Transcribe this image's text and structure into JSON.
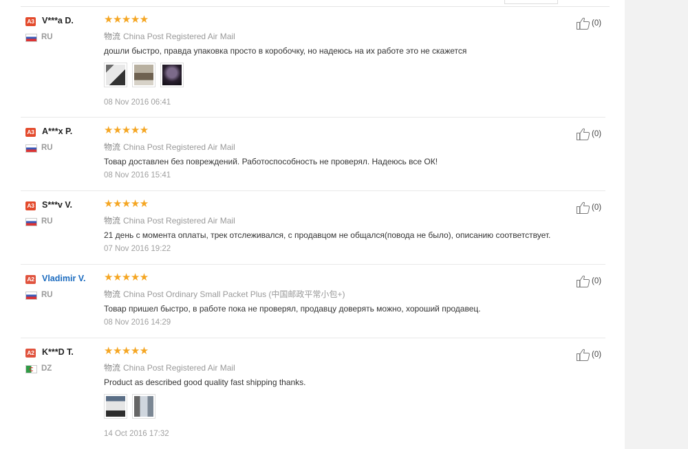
{
  "logistics_label": "物流",
  "icons": {
    "helpful": "thumbs-up-icon",
    "rating": "star-icon"
  },
  "colors": {
    "stars": "#f5a623",
    "badge": "#e34a2c",
    "buyer_highlight": "#1b6bbf"
  },
  "reviews": [
    {
      "level": "A3",
      "buyer": "V***a D.",
      "country": "RU",
      "stars": "★★★★★",
      "rating": 5,
      "shipping": "China Post Registered Air Mail",
      "feedback": "дошли быстро, правда упаковка просто в коробочку, но надеюсь на их работе это не скажется",
      "photos": 3,
      "date": "08 Nov 2016 06:41",
      "helpful": "(0)"
    },
    {
      "level": "A3",
      "buyer": "A***x P.",
      "country": "RU",
      "stars": "★★★★★",
      "rating": 5,
      "shipping": "China Post Registered Air Mail",
      "feedback": "Товар доставлен без повреждений. Работоспособность не проверял. Надеюсь все ОК!",
      "photos": 0,
      "date": "08 Nov 2016 15:41",
      "helpful": "(0)"
    },
    {
      "level": "A3",
      "buyer": "S***v V.",
      "country": "RU",
      "stars": "★★★★★",
      "rating": 5,
      "shipping": "China Post Registered Air Mail",
      "feedback": "21 день с момента оплаты, трек отслеживался, с продавцом не общался(повода не было), описанию соответствует.",
      "photos": 0,
      "date": "07 Nov 2016 19:22",
      "helpful": "(0)"
    },
    {
      "level": "A2",
      "buyer": "Vladimir V.",
      "country": "RU",
      "stars": "★★★★★",
      "rating": 5,
      "shipping": "China Post Ordinary Small Packet Plus (中国邮政平常小包+)",
      "feedback": "Товар пришел быстро, в работе пока не проверял, продавцу доверять можно, хороший продавец.",
      "photos": 0,
      "date": "08 Nov 2016 14:29",
      "helpful": "(0)"
    },
    {
      "level": "A2",
      "buyer": "K***D T.",
      "country": "DZ",
      "stars": "★★★★★",
      "rating": 5,
      "shipping": "China Post Registered Air Mail",
      "feedback": "Product as described good quality fast shipping thanks.",
      "photos": 2,
      "date": "14 Oct 2016 17:32",
      "helpful": "(0)"
    }
  ]
}
